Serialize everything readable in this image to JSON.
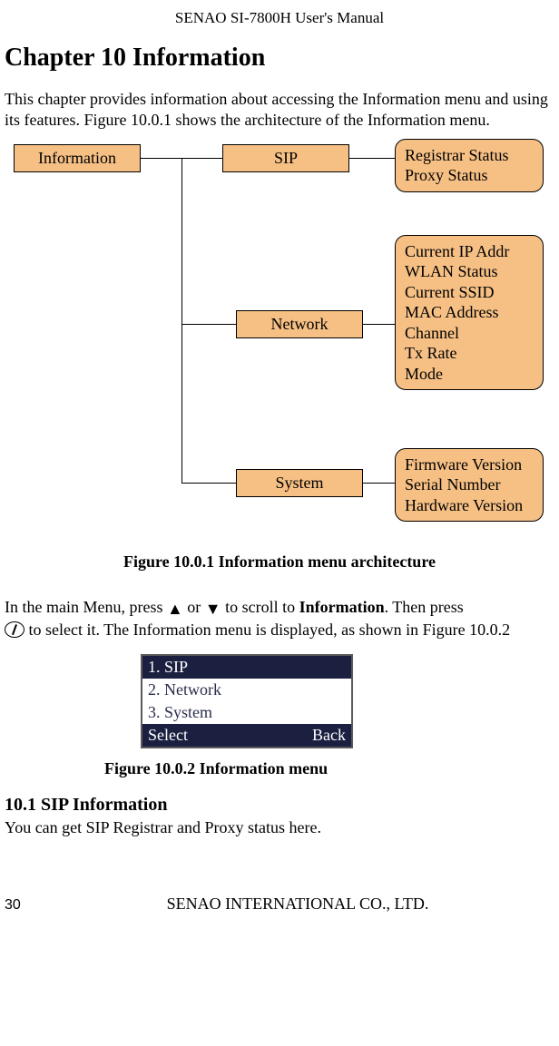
{
  "running_head": "SENAO SI-7800H User's Manual",
  "chapter_title": "Chapter 10 Information",
  "intro_para": "This chapter provides information about accessing the Information menu and using its features. Figure 10.0.1 shows the architecture of the Information menu.",
  "diagram": {
    "root": "Information",
    "nodes": {
      "sip": "SIP",
      "network": "Network",
      "system": "System"
    },
    "sip_items": [
      "Registrar Status",
      "Proxy Status"
    ],
    "network_items": [
      "Current IP Addr",
      "WLAN Status",
      "Current SSID",
      "MAC Address",
      "Channel",
      "Tx Rate",
      "Mode"
    ],
    "system_items": [
      "Firmware Version",
      "Serial Number",
      "Hardware Version"
    ]
  },
  "fig1_caption": "Figure 10.0.1 Information menu architecture",
  "nav_para_1a": "In the main Menu, press ",
  "tri_up": "▲",
  "nav_or": " or ",
  "tri_down": "▼",
  "nav_para_1b": " to scroll to ",
  "nav_bold": "Information",
  "nav_para_1c": ". Then press ",
  "nav_para_2": " to select it. The Information menu is displayed, as shown in Figure 10.0.2",
  "phone_menu": {
    "items": [
      "1. SIP",
      "2. Network",
      "3. System"
    ],
    "soft_left": "Select",
    "soft_right": "Back"
  },
  "fig2_caption": "Figure 10.0.2 Information menu",
  "section_101_title": "10.1 SIP Information",
  "section_101_body": "You can get SIP Registrar and Proxy status here.",
  "page_number": "30",
  "footer_org": "SENAO INTERNATIONAL CO., LTD."
}
